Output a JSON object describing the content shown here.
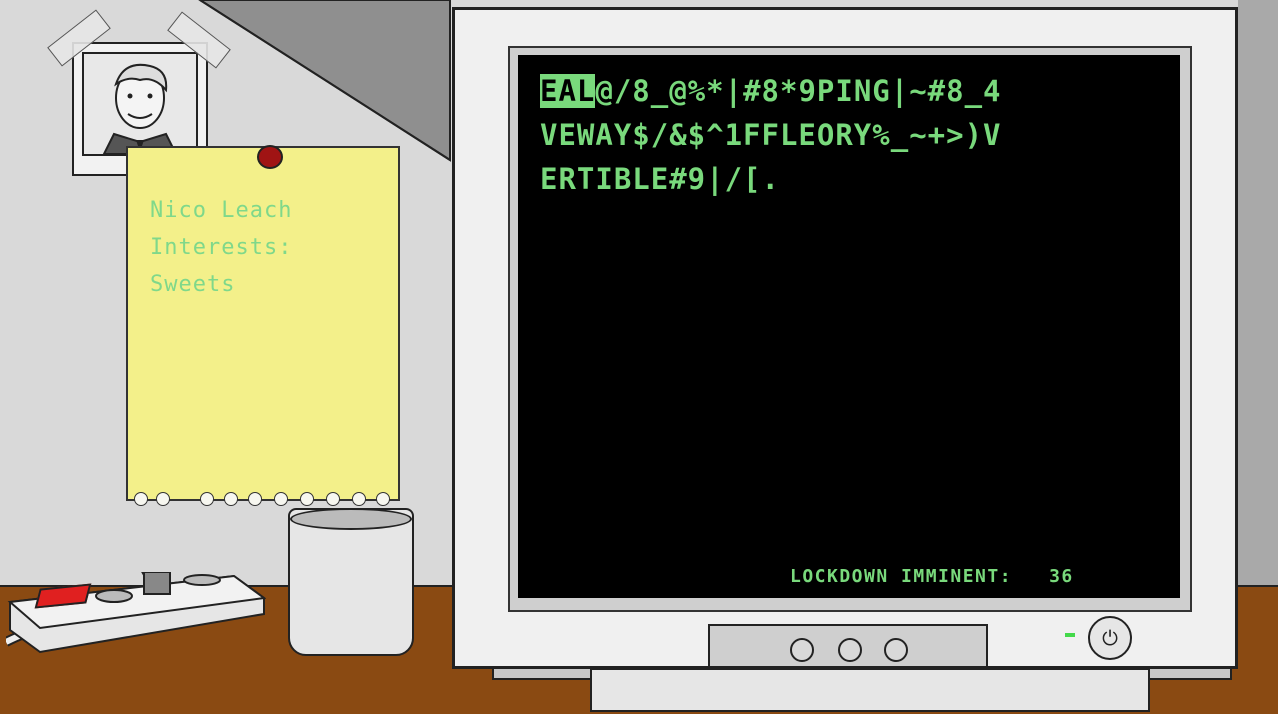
{
  "note": {
    "name": "Nico Leach",
    "interests_label": "Interests:",
    "interest": "Sweets"
  },
  "terminal": {
    "cursor_text": "EAL",
    "line1_rest": "@/8_@%*|#8*9PING|~#8_4",
    "line2": "VEWAY$/&$^1FFLEORY%_~+>)V",
    "line3": "ERTIBLE#9|/[.",
    "lockdown_label": "LOCKDOWN IMMINENT:",
    "lockdown_count": "36"
  },
  "monitor": {
    "power_icon": "power-icon",
    "led_color": "#43d94a",
    "screen_text_color": "#79d97c"
  },
  "colors": {
    "note": "#f3f08a",
    "pin": "#a01414",
    "desk": "#8a4a12",
    "switch_red": "#e02020"
  }
}
